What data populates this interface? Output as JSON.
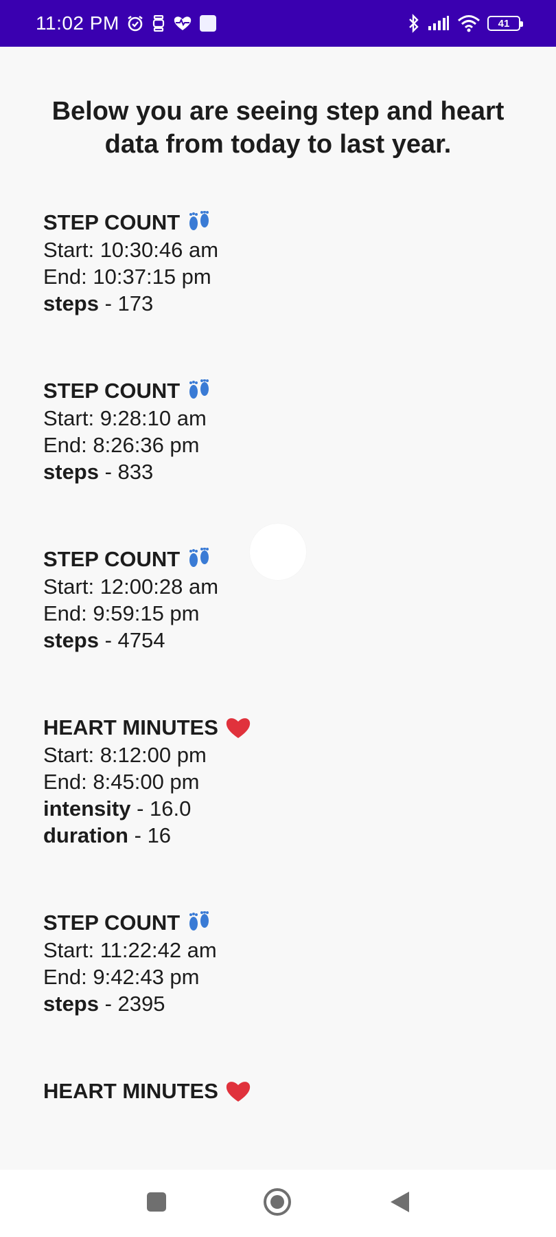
{
  "status_bar": {
    "time": "11:02 PM",
    "battery": "41",
    "icons": [
      "alarm-icon",
      "fit-icon",
      "heart-pulse-icon",
      "app-square-icon",
      "bluetooth-icon",
      "signal-icon",
      "wifi-icon",
      "battery-icon"
    ]
  },
  "intro": "Below you are seeing step and heart data from today to last year.",
  "records": [
    {
      "title": "STEP COUNT",
      "emoji": "footprints",
      "start": "Start: 10:30:46 am",
      "end": "End: 10:37:15 pm",
      "fields": [
        {
          "label": "steps",
          "value": "173"
        }
      ]
    },
    {
      "title": "STEP COUNT",
      "emoji": "footprints",
      "start": "Start: 9:28:10 am",
      "end": "End: 8:26:36 pm",
      "fields": [
        {
          "label": "steps",
          "value": "833"
        }
      ]
    },
    {
      "title": "STEP COUNT",
      "emoji": "footprints",
      "start": "Start: 12:00:28 am",
      "end": "End: 9:59:15 pm",
      "fields": [
        {
          "label": "steps",
          "value": "4754"
        }
      ]
    },
    {
      "title": "HEART MINUTES",
      "emoji": "red-heart",
      "start": "Start: 8:12:00 pm",
      "end": "End: 8:45:00 pm",
      "fields": [
        {
          "label": "intensity",
          "value": "16.0"
        },
        {
          "label": "duration",
          "value": "16"
        }
      ]
    },
    {
      "title": "STEP COUNT",
      "emoji": "footprints",
      "start": "Start: 11:22:42 am",
      "end": "End: 9:42:43 pm",
      "fields": [
        {
          "label": "steps",
          "value": "2395"
        }
      ]
    },
    {
      "title": "HEART MINUTES",
      "emoji": "red-heart",
      "start": "",
      "end": "",
      "fields": []
    }
  ],
  "nav_bar": {
    "icons": [
      "recents-square-icon",
      "home-circle-icon",
      "back-triangle-icon"
    ]
  },
  "colors": {
    "status_bar": "#3a00b0",
    "background": "#f8f8f8",
    "text": "#1c1c1c",
    "footprints": "#3a7bd5",
    "heart": "#e0323c"
  }
}
